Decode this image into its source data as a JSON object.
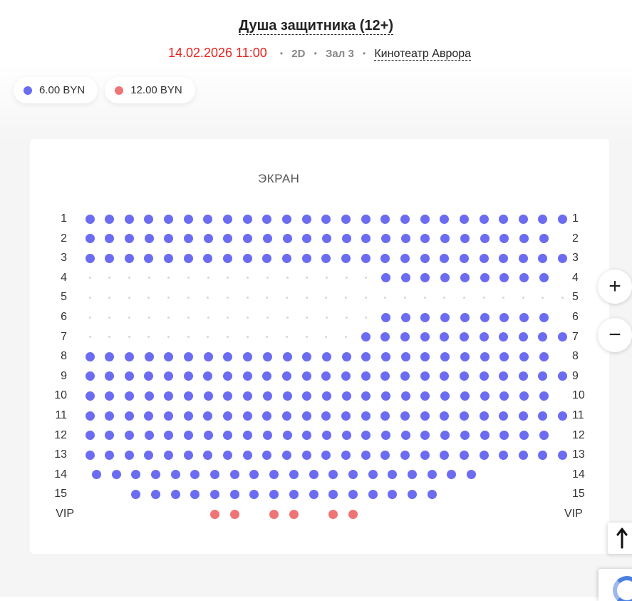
{
  "movie": {
    "title": "Душа защитника (12+)",
    "datetime": "14.02.2026 11:00",
    "format": "2D",
    "hall": "Зал 3",
    "cinema": "Кинотеатр Аврора",
    "separator": "•"
  },
  "prices": [
    {
      "label": "6.00 BYN",
      "color": "#6b6cf1"
    },
    {
      "label": "12.00 BYN",
      "color": "#ef7575"
    }
  ],
  "colors": {
    "accent_red": "#e8231e",
    "seat_standard": "#6b6cf1",
    "seat_vip": "#ef7575",
    "seat_unavailable": "#d6d6d6"
  },
  "hall": {
    "screen_label": "ЭКРАН",
    "rows": [
      {
        "label": "1",
        "pattern": "SSSSSSSSSSSSSSSSSSSSSSSSS"
      },
      {
        "label": "2",
        "pattern": "SSSSSSSSSSSSSSSSSSSSSSSS"
      },
      {
        "label": "3",
        "pattern": "SSSSSSSSSSSSSSSSSSSSSSSSS"
      },
      {
        "label": "4",
        "pattern": "xxxxxxxxxxxxxxxSSSSSSSSS"
      },
      {
        "label": "5",
        "pattern": "xxxxxxxxxxxxxxxxxxxxxxxxx"
      },
      {
        "label": "6",
        "pattern": "xxxxxxxxxxxxxxxSSSSSSSSS"
      },
      {
        "label": "7",
        "pattern": "xxxxxxxxxxxxxxSSSSSSSSSSS"
      },
      {
        "label": "8",
        "pattern": "SSSSSSSSSSSSSSSSSSSSSSSS"
      },
      {
        "label": "9",
        "pattern": "SSSSSSSSSSSSSSSSSSSSSSSSS"
      },
      {
        "label": "10",
        "pattern": "SSSSSSSSSSSSSSSSSSSSSSSS"
      },
      {
        "label": "11",
        "pattern": "SSSSSSSSSSSSSSSSSSSSSSSSS"
      },
      {
        "label": "12",
        "pattern": "SSSSSSSSSSSSSSSSSSSSSSSS"
      },
      {
        "label": "13",
        "pattern": "SSSSSSSSSSSSSSSSSSSSSSSSS"
      },
      {
        "label": "14",
        "pattern": "SSSSSSSSSSSSSSSSSSSS"
      },
      {
        "label": "15",
        "pattern": "SSSSSSSSSSSSSSSS"
      },
      {
        "label": "VIP",
        "pattern": "VV_VV_VV"
      }
    ]
  },
  "controls": {
    "zoom_in": "+",
    "zoom_out": "−",
    "scroll_top_icon": "arrow-up-icon"
  }
}
